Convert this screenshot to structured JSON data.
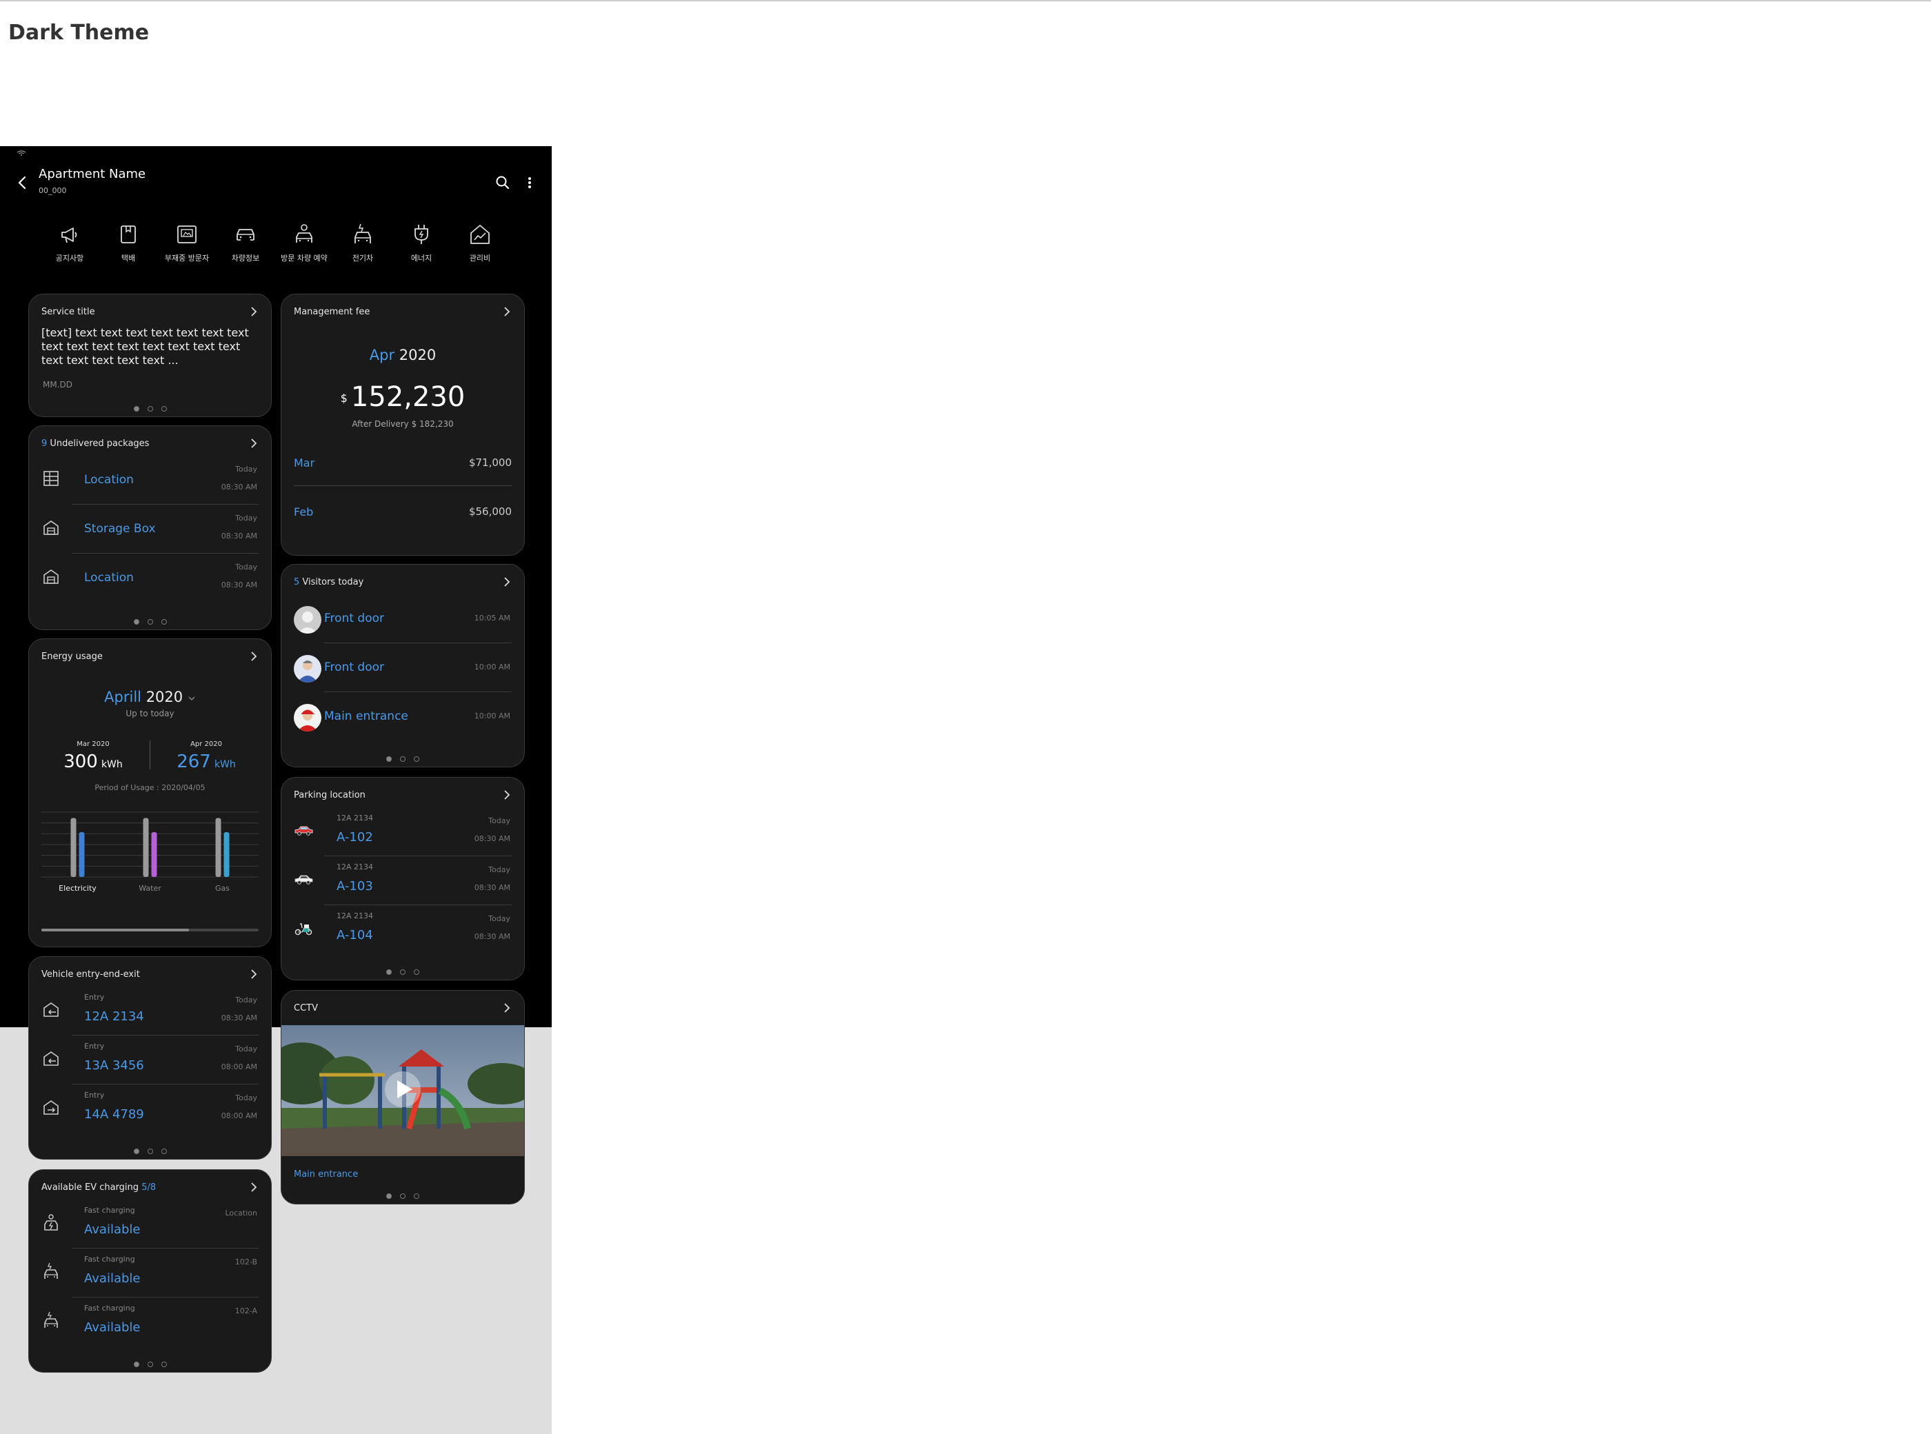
{
  "page": {
    "heading": "Dark Theme"
  },
  "appbar": {
    "title": "Apartment Name",
    "subtitle": "00_000"
  },
  "quick_menu": [
    {
      "icon": "megaphone-icon",
      "label": "공지사항"
    },
    {
      "icon": "parcel-box-icon",
      "label": "택배"
    },
    {
      "icon": "absent-visitor-icon",
      "label": "부재중 방문자"
    },
    {
      "icon": "car-icon",
      "label": "차량정보"
    },
    {
      "icon": "visitor-car-reservation-icon",
      "label": "방문 차량 예약"
    },
    {
      "icon": "ev-car-icon",
      "label": "전기차"
    },
    {
      "icon": "energy-plug-icon",
      "label": "에너지"
    },
    {
      "icon": "management-fee-icon",
      "label": "관리비"
    }
  ],
  "service": {
    "title": "Service title",
    "text": "[text] text text text text text text text text text text text text text text text text text text text text ...",
    "date": "MM.DD"
  },
  "packages": {
    "count": "9",
    "title": "Undelivered packages",
    "items": [
      {
        "icon": "locker-icon",
        "label": "Location",
        "day": "Today",
        "time": "08:30 AM"
      },
      {
        "icon": "storage-box-icon",
        "label": "Storage Box",
        "day": "Today",
        "time": "08:30 AM"
      },
      {
        "icon": "storage-box-icon",
        "label": "Location",
        "day": "Today",
        "time": "08:30 AM"
      }
    ]
  },
  "energy": {
    "title": "Energy usage",
    "month": "Aprill",
    "year": "2020",
    "up_to": "Up to today",
    "prev_label": "Mar 2020",
    "prev_value": "300",
    "cur_label": "Apr 2020",
    "cur_value": "267",
    "unit": "kWh",
    "period": "Period of Usage : 2020/04/05"
  },
  "chart_data": {
    "type": "bar",
    "categories": [
      "Electricity",
      "Water",
      "Gas"
    ],
    "series": [
      {
        "values": [
          100,
          100,
          100
        ]
      },
      {
        "values": [
          76,
          76,
          76
        ]
      }
    ],
    "colors": {
      "previous": "#9a9a9a",
      "Electricity": "#3f7fd4",
      "Water": "#b560d8",
      "Gas": "#3aa0d0"
    },
    "ylim": [
      0,
      110
    ],
    "grid": true,
    "scroll_progress": 0.68
  },
  "vehicles": {
    "title": "Vehicle entry-end-exit",
    "items": [
      {
        "icon": "entry-icon",
        "type": "Entry",
        "plate": "12A 2134",
        "day": "Today",
        "time": "08:30 AM"
      },
      {
        "icon": "entry-icon",
        "type": "Entry",
        "plate": "13A 3456",
        "day": "Today",
        "time": "08:00 AM"
      },
      {
        "icon": "exit-icon",
        "type": "Entry",
        "plate": "14A 4789",
        "day": "Today",
        "time": "08:00 AM"
      }
    ]
  },
  "ev": {
    "title": "Available EV charging",
    "count": "5/8",
    "items": [
      {
        "icon": "ev-charger-icon",
        "type": "Fast charging",
        "status": "Available",
        "loc": "Location"
      },
      {
        "icon": "ev-car-icon",
        "type": "Fast charging",
        "status": "Available",
        "loc": "102-B"
      },
      {
        "icon": "ev-car-icon",
        "type": "Fast charging",
        "status": "Available",
        "loc": "102-A"
      }
    ]
  },
  "fee": {
    "title": "Management fee",
    "month": "Apr",
    "year": "2020",
    "currency": "$",
    "amount": "152,230",
    "after": "After Delivery $ 182,230",
    "history": [
      {
        "month": "Mar",
        "amount": "$71,000"
      },
      {
        "month": "Feb",
        "amount": "$56,000"
      }
    ]
  },
  "visitors": {
    "count": "5",
    "title": "Visitors today",
    "items": [
      {
        "label": "Front door",
        "time": "10:05 AM"
      },
      {
        "label": "Front door",
        "time": "10:00 AM"
      },
      {
        "label": "Main entrance",
        "time": "10:00 AM"
      }
    ]
  },
  "parking": {
    "title": "Parking location",
    "items": [
      {
        "icon": "red-car-icon",
        "plate": "12A 2134",
        "spot": "A-102",
        "day": "Today",
        "time": "08:30 AM"
      },
      {
        "icon": "white-car-icon",
        "plate": "12A 2134",
        "spot": "A-103",
        "day": "Today",
        "time": "08:30 AM"
      },
      {
        "icon": "scooter-icon",
        "plate": "12A 2134",
        "spot": "A-104",
        "day": "Today",
        "time": "08:30 AM"
      }
    ]
  },
  "cctv": {
    "title": "CCTV",
    "caption": "Main entrance"
  }
}
